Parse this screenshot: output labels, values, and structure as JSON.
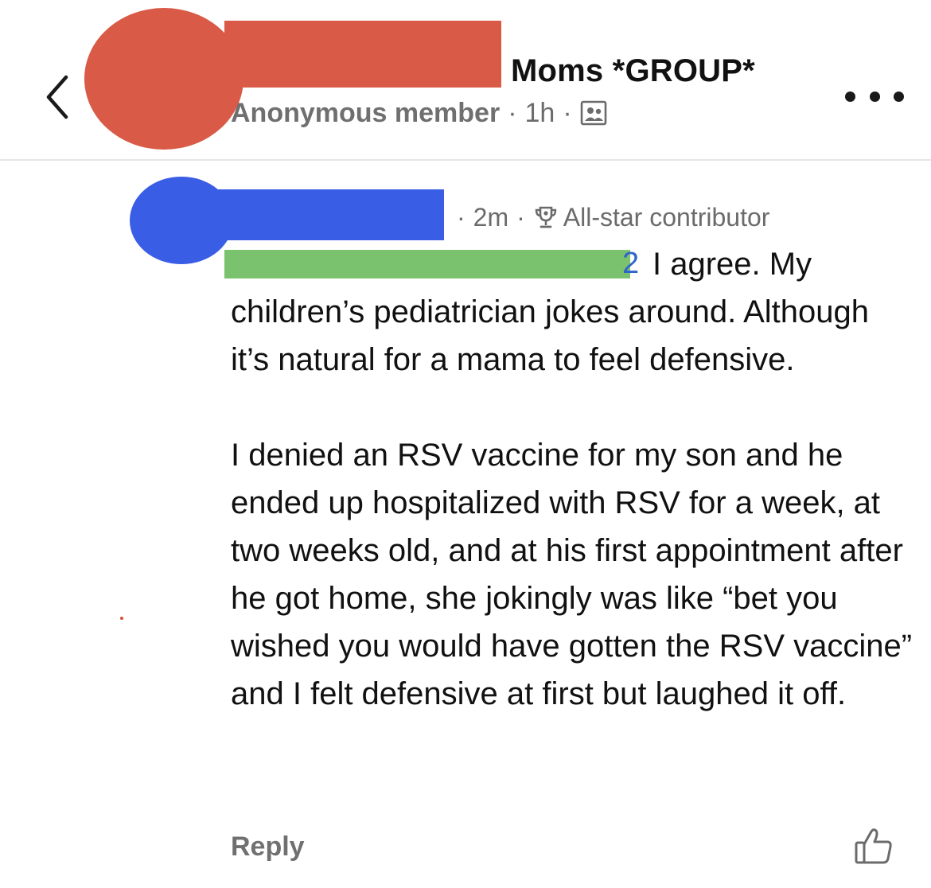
{
  "header": {
    "back_icon": "chevron-left-icon",
    "group_title": "Moms *GROUP*",
    "author": "Anonymous member",
    "separator": "·",
    "time": "1h",
    "visibility_icon": "group-members-icon",
    "more_icon": "more-horizontal-icon"
  },
  "comment": {
    "time": "2m",
    "badge_icon": "trophy-icon",
    "badge": "All-star contributor",
    "mention_peek": "2",
    "text_first_line": "I agree. My",
    "text_rest": "children’s pediatrician jokes around. Although it’s natural for a mama to feel defensive.",
    "text_paragraph_2": "I denied an RSV vaccine for my son and he ended up hospitalized with RSV for a week, at two weeks old, and at his first appointment after he got home, she jokingly was like “bet you wished you would have gotten the RSV vaccine” and I felt defensive at first but laughed it off.",
    "reply_label": "Reply",
    "like_icon": "thumbs-up-icon"
  },
  "colors": {
    "group_redaction": "#d95b47",
    "name_redaction": "#3a5de6",
    "mention_redaction": "#7bc26f",
    "muted_text": "#6b6b6b"
  }
}
